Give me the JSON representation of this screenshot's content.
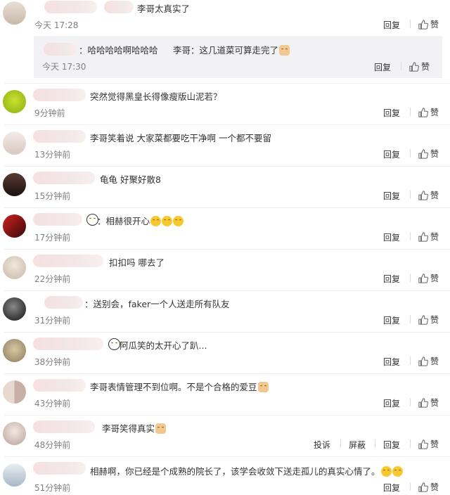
{
  "actions": {
    "reply": "回复",
    "like": "赞",
    "report": "投诉",
    "block": "屏蔽"
  },
  "comments": [
    {
      "text": "李哥太真实了",
      "time": "今天 17:28"
    },
    {
      "text": "突然觉得黑皇长得像瘦版山泥若？",
      "time": "9分钟前"
    },
    {
      "text": "李哥笑着说 大家菜都要吃干净啊 一个都不要留",
      "time": "13分钟前"
    },
    {
      "text": "龟龟 好聚好散8",
      "time": "15分钟前"
    },
    {
      "text": "：相赫很开心",
      "time": "17分钟前"
    },
    {
      "text": "扣扣吗 哪去了",
      "time": "22分钟前"
    },
    {
      "text": "：送别会，faker一个人送走所有队友",
      "time": "31分钟前"
    },
    {
      "text": "阿瓜笑的太开心了趴...",
      "time": "38分钟前"
    },
    {
      "text": "李哥表情管理不到位啊。不是个合格的爱豆",
      "time": "43分钟前"
    },
    {
      "text": "李哥笑得真实",
      "time": "48分钟前"
    },
    {
      "text": "相赫啊，你已经是个成熟的院长了，该学会收敛下送走孤儿的真实心情了。",
      "time": "51分钟前"
    }
  ],
  "nested_reply": {
    "text1": "：哈哈哈哈啊哈哈哈",
    "text2": "李哥：这几道菜可算走完了",
    "time": "今天 17:30"
  }
}
